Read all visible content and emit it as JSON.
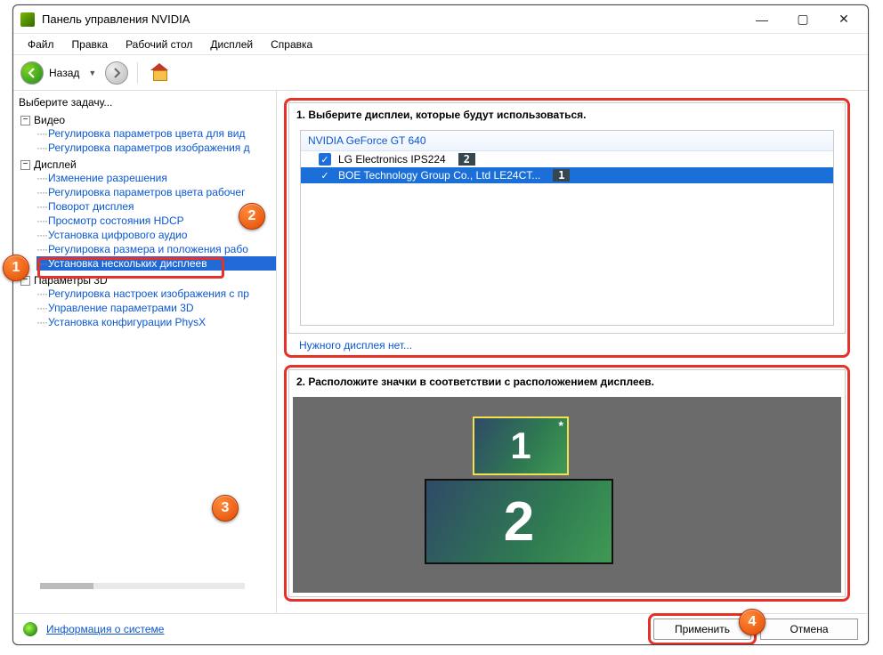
{
  "window": {
    "title": "Панель управления NVIDIA"
  },
  "menu": {
    "file": "Файл",
    "edit": "Правка",
    "desktop": "Рабочий стол",
    "display": "Дисплей",
    "help": "Справка"
  },
  "toolbar": {
    "back": "Назад"
  },
  "sidebar": {
    "task_header": "Выберите задачу...",
    "video": {
      "label": "Видео",
      "items": [
        "Регулировка параметров цвета для вид",
        "Регулировка параметров изображения д"
      ]
    },
    "display": {
      "label": "Дисплей",
      "items": [
        "Изменение разрешения",
        "Регулировка параметров цвета рабочег",
        "Поворот дисплея",
        "Просмотр состояния HDCP",
        "Установка цифрового аудио",
        "Регулировка размера и положения рабо",
        "Установка нескольких дисплеев"
      ],
      "selected_index": 6
    },
    "params3d": {
      "label": "Параметры 3D",
      "items": [
        "Регулировка настроек изображения с пр",
        "Управление параметрами 3D",
        "Установка конфигурации PhysX"
      ]
    }
  },
  "main": {
    "section1": {
      "title": "1. Выберите дисплеи, которые будут использоваться.",
      "gpu": "NVIDIA GeForce GT 640",
      "displays": [
        {
          "name": "LG Electronics IPS224",
          "tag": "2",
          "checked": true,
          "selected": false
        },
        {
          "name": "BOE Technology Group Co., Ltd LE24CT...",
          "tag": "1",
          "checked": true,
          "selected": true
        }
      ],
      "missing": "Нужного дисплея нет..."
    },
    "section2": {
      "title": "2. Расположите значки в соответствии с расположением дисплеев.",
      "disp1": "1",
      "disp2": "2"
    }
  },
  "footer": {
    "system_info": "Информация о системе",
    "apply": "Применить",
    "cancel": "Отмена"
  },
  "callouts": {
    "c1": "1",
    "c2": "2",
    "c3": "3",
    "c4": "4"
  }
}
